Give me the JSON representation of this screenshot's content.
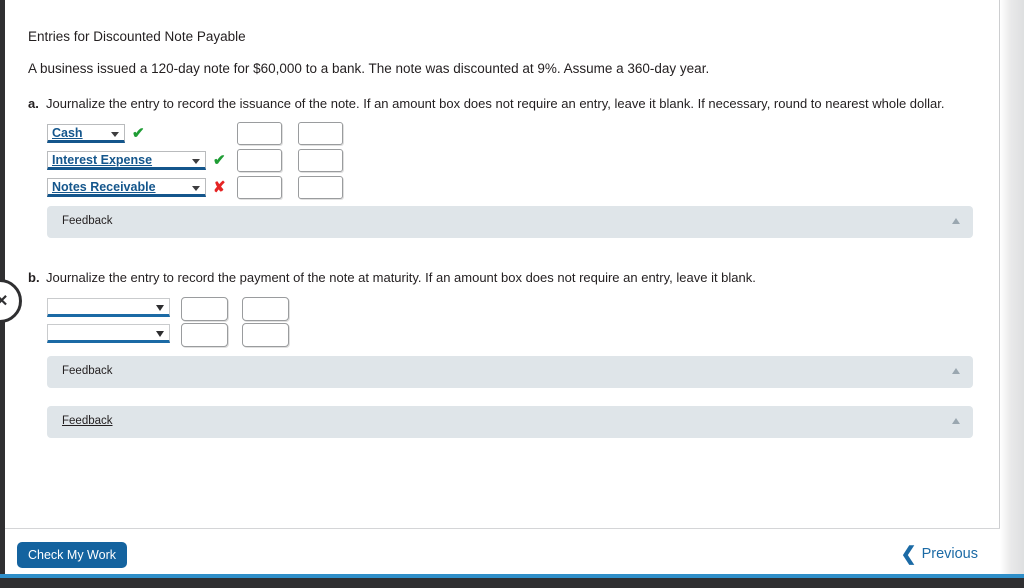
{
  "question": {
    "title": "Entries for Discounted Note Payable",
    "body": "A business issued a 120-day note for $60,000 to a bank. The note was discounted at 9%. Assume a 360-day year."
  },
  "parts": [
    {
      "label": "a.",
      "text": "Journalize the entry to record the issuance of the note. If an amount box does not require an entry, leave it blank. If necessary, round to nearest whole dollar.",
      "rows": [
        {
          "account": "Cash",
          "mark": "✔",
          "mark_type": "correct",
          "debit": "",
          "credit": ""
        },
        {
          "account": "Interest Expense",
          "mark": "✔",
          "mark_type": "correct",
          "debit": "",
          "credit": ""
        },
        {
          "account": "Notes Receivable",
          "mark": "✘",
          "mark_type": "incorrect",
          "debit": "",
          "credit": ""
        }
      ],
      "feedback_label": "Feedback"
    },
    {
      "label": "b.",
      "text": "Journalize the entry to record the payment of the note at maturity. If an amount box does not require an entry, leave it blank.",
      "rows": [
        {
          "account": "",
          "mark": "",
          "mark_type": "none",
          "debit": "",
          "credit": ""
        },
        {
          "account": "",
          "mark": "",
          "mark_type": "none",
          "debit": "",
          "credit": ""
        }
      ],
      "feedback_label": "Feedback"
    }
  ],
  "overall_feedback_label": "Feedback",
  "help_widget": {
    "glyph": "✕"
  },
  "action_bar": {
    "check_label": "Check My Work",
    "previous_label": "Previous",
    "previous_chevron": "❮"
  },
  "colors": {
    "accent_blue": "#14639f",
    "link_blue": "#1b6aa5",
    "select_blue": "#14568c",
    "correct_green": "#1f9d35",
    "incorrect_red": "#e52424",
    "feedback_bg": "#dfe5e9",
    "rail_dark": "#2f2f31",
    "bottom_blue": "#2f8fc9"
  }
}
